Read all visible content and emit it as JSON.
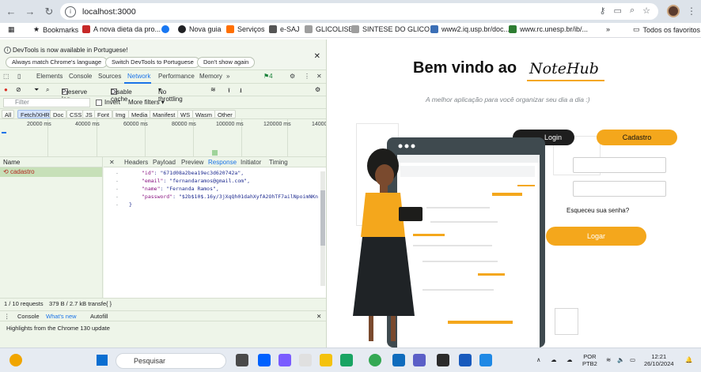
{
  "browser": {
    "url": "localhost:3000",
    "bookmarks": [
      {
        "label": "Bookmarks",
        "color": "#202124"
      },
      {
        "label": "A nova dieta da pro...",
        "color": "#c62828"
      },
      {
        "label": "",
        "color": "#1877f2"
      },
      {
        "label": "Nova guia",
        "color": "#202124"
      },
      {
        "label": "Serviços",
        "color": "#ff6f00"
      },
      {
        "label": "e-SAJ",
        "color": "#555555"
      },
      {
        "label": "GLICOLISE",
        "color": "#6d6d6d"
      },
      {
        "label": "SINTESE DO GLICO...",
        "color": "#6d6d6d"
      },
      {
        "label": "www2.iq.usp.br/doc...",
        "color": "#3b6fb6"
      },
      {
        "label": "www.rc.unesp.br/ib/...",
        "color": "#2e7d32"
      }
    ],
    "all_favorites": "Todos os favoritos"
  },
  "devtools": {
    "info_message": "DevTools is now available in Portuguese!",
    "info_buttons": [
      "Always match Chrome's language",
      "Switch DevTools to Portuguese",
      "Don't show again"
    ],
    "tabs": [
      "Elements",
      "Console",
      "Sources",
      "Network",
      "Performance",
      "Memory"
    ],
    "active_tab": "Network",
    "issues_count": "4",
    "preserve_log": "Preserve log",
    "disable_cache": "Disable cache",
    "throttling": "No throttling",
    "filter_placeholder": "Filter",
    "invert": "Invert",
    "more_filters": "More filters",
    "types": [
      "All",
      "Fetch/XHR",
      "Doc",
      "CSS",
      "JS",
      "Font",
      "Img",
      "Media",
      "Manifest",
      "WS",
      "Wasm",
      "Other"
    ],
    "active_type": "Fetch/XHR",
    "timeline_labels": [
      "20000 ms",
      "40000 ms",
      "60000 ms",
      "80000 ms",
      "100000 ms",
      "120000 ms",
      "14000"
    ],
    "name_header": "Name",
    "request_name": "cadastro",
    "detail_tabs": [
      "Headers",
      "Payload",
      "Preview",
      "Response",
      "Initiator",
      "Timing"
    ],
    "active_detail_tab": "Response",
    "response_lines": [
      {
        "key": "\"id\"",
        "value": "\"671d08a2bea19ec3d620742a\","
      },
      {
        "key": "\"email\"",
        "value": "\"fernandaramos@gmail.com\","
      },
      {
        "key": "\"name\"",
        "value": "\"Fernanda Ramos\","
      },
      {
        "key": "\"password\"",
        "value": "\"$2b$10$.16y/3jXqQh01dahXyfA2OhTF7ailNpoimNKn"
      }
    ],
    "closing_brace": "}",
    "status_requests": "1 / 10 requests",
    "status_transfer": "379 B / 2.7 kB transfe",
    "drawer_tabs": [
      "Console",
      "What's new",
      "Autofill"
    ],
    "drawer_text": "Highlights from the Chrome 130 update"
  },
  "page": {
    "welcome": "Bem vindo ao",
    "brand": "NoteHub",
    "subtitle": "A melhor aplicação para você organizar seu dia a dia :)",
    "login_tab": "Login",
    "cadastro_tab": "Cadastro",
    "forgot": "Esqueceu sua senha?",
    "submit": "Logar",
    "accent": "#f4a71c"
  },
  "taskbar": {
    "search": "Pesquisar",
    "lang": "POR",
    "layout": "PTB2",
    "time": "12:21",
    "date": "26/10/2024"
  }
}
